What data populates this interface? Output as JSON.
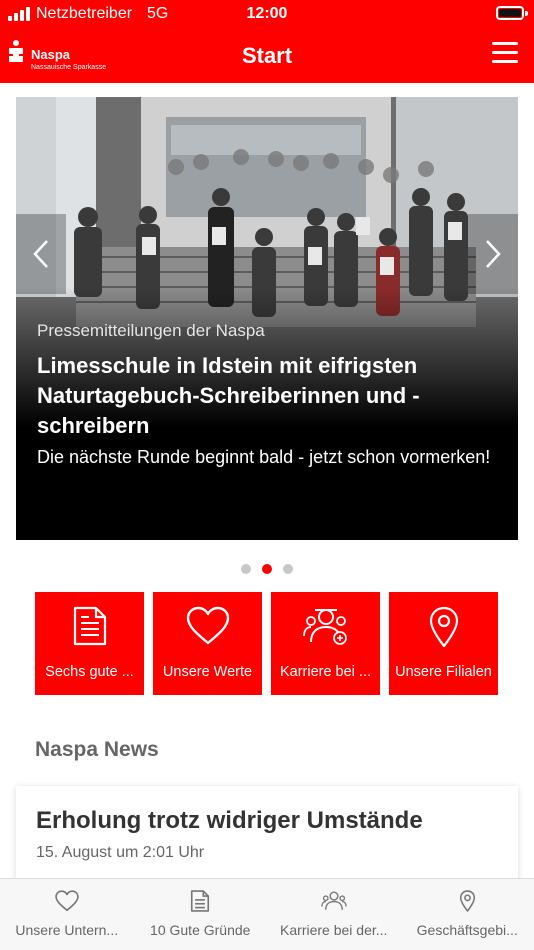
{
  "status_bar": {
    "carrier": "Netzbetreiber",
    "network": "5G",
    "time": "12:00"
  },
  "header": {
    "logo_name": "Naspa",
    "logo_sub": "Nassauische Sparkasse",
    "title": "Start",
    "menu_icon": "hamburger-menu-icon"
  },
  "colors": {
    "brand_red": "#ff0000",
    "text_grey": "#666666",
    "dot_inactive": "#c8c8c8"
  },
  "carousel": {
    "category": "Pressemitteilungen der Naspa",
    "headline": "Limesschule in Idstein mit eifrigsten Naturtagebuch-Schreiberinnen und -schreibern",
    "subtitle": "Die nächste Runde beginnt bald - jetzt schon vormerken!",
    "slide_count": 3,
    "active_slide": 2,
    "prev_icon": "chevron-left-icon",
    "next_icon": "chevron-right-icon"
  },
  "tiles": [
    {
      "label": "Sechs gute ...",
      "icon": "document-icon"
    },
    {
      "label": "Unsere Werte",
      "icon": "heart-icon"
    },
    {
      "label": "Karriere bei ...",
      "icon": "people-icon"
    },
    {
      "label": "Unsere Filialen",
      "icon": "location-pin-icon"
    }
  ],
  "news": {
    "section_title": "Naspa News",
    "items": [
      {
        "title": "Erholung trotz widriger Umstände",
        "date": "15. August um 2:01 Uhr"
      }
    ]
  },
  "tabbar": [
    {
      "label": "Unsere Untern...",
      "icon": "heart-icon"
    },
    {
      "label": "10 Gute Gründe",
      "icon": "document-icon"
    },
    {
      "label": "Karriere bei der...",
      "icon": "people-icon"
    },
    {
      "label": "Geschäftsgebi...",
      "icon": "location-pin-icon"
    }
  ]
}
